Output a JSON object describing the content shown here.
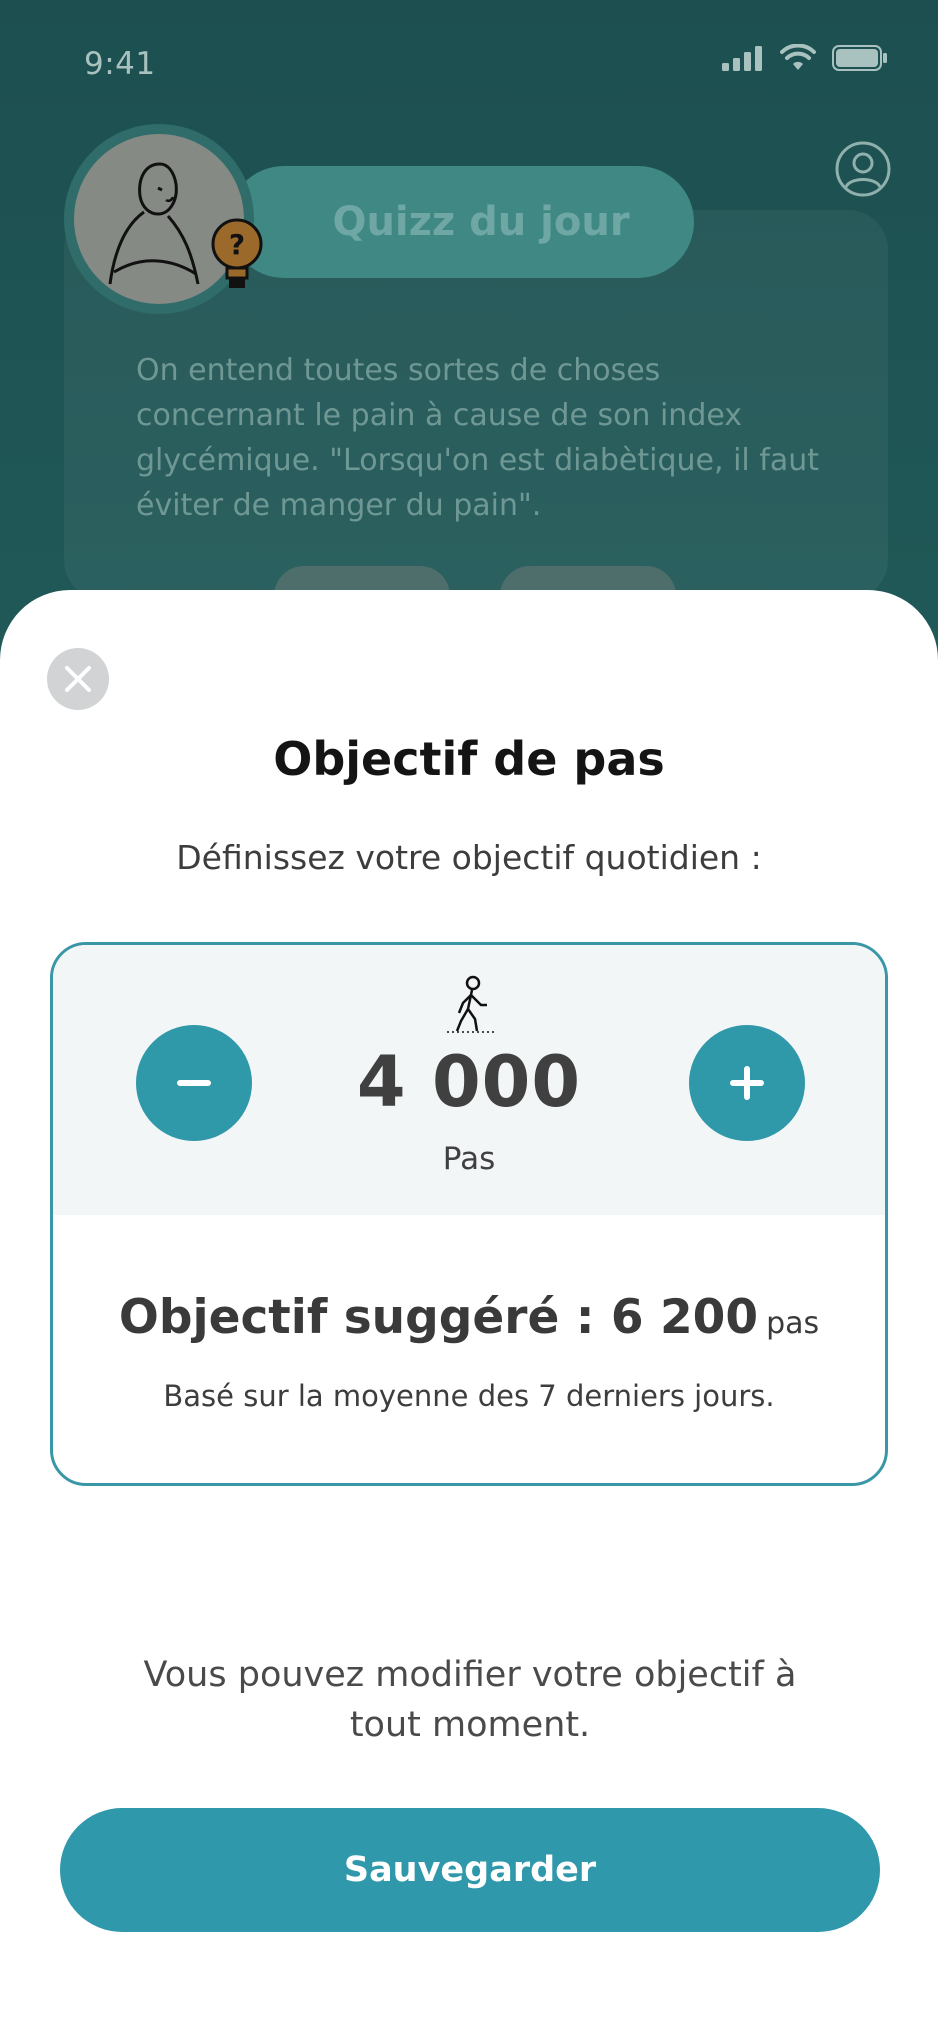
{
  "status_bar": {
    "time": "9:41"
  },
  "background": {
    "quiz_title": "Quizz du jour",
    "quiz_text": "On entend toutes sortes de choses concernant le pain à cause de son index glycémique. \"Lorsqu'on est diabètique, il faut éviter de manger du pain\"."
  },
  "sheet": {
    "title": "Objectif de pas",
    "subtitle": "Définissez votre objectif quotidien :",
    "goal": {
      "value": "4 000",
      "unit": "Pas",
      "suggested_label": "Objectif suggéré : ",
      "suggested_value": "6 200",
      "suggested_unit": "pas",
      "note": "Basé sur la moyenne des 7 derniers jours."
    },
    "info": "Vous pouvez modifier votre objectif à tout moment.",
    "save_label": "Sauvegarder"
  },
  "colors": {
    "accent": "#2f98ab",
    "overlay_bg": "#1f5a57",
    "goal_panel_bg": "#f2f6f6"
  },
  "icons": {
    "close": "close-icon",
    "walk": "walking-person-icon",
    "minus": "minus-icon",
    "plus": "plus-icon",
    "profile": "user-profile-icon"
  }
}
